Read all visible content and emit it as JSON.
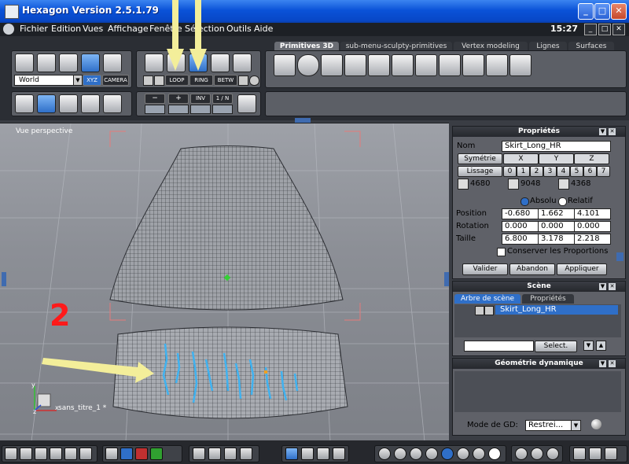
{
  "window": {
    "title": "Hexagon Version 2.5.1.79",
    "min_glyph": "_",
    "max_glyph": "□",
    "close_glyph": "✕"
  },
  "menubar": {
    "items": [
      "Fichier",
      "Edition",
      "Vues",
      "Affichage",
      "Fenêtre",
      "Sélection",
      "Outils",
      "Aide"
    ],
    "clock": "15:27",
    "min_glyph": "_",
    "max_glyph": "□",
    "close_glyph": "✕"
  },
  "toolbar": {
    "coord_select": "World",
    "xyz_label": "XYZ",
    "camera_label": "CAMERA",
    "loop_label": "LOOP",
    "ring_label": "RING",
    "betw_label": "BETW",
    "minus_label": "−",
    "plus_label": "+",
    "inv_label": "INV",
    "one_n_label": "1 / N",
    "tabs": [
      "Primitives 3D",
      "sub-menu-sculpty-primitives",
      "Vertex modeling",
      "Lignes",
      "Surfaces"
    ],
    "active_tab": "Primitives 3D"
  },
  "viewport": {
    "label": "Vue perspective",
    "step_number": "2",
    "object_label": "sans_titre_1 *",
    "axis_x": "x",
    "axis_y": "y",
    "axis_z": "z"
  },
  "properties": {
    "title": "Propriétés",
    "name_label": "Nom",
    "name_value": "Skirt_Long_HR",
    "symetrie_label": "Symétrie",
    "axes": [
      "X",
      "Y",
      "Z"
    ],
    "lissage_label": "Lissage",
    "lissage_levels": [
      "0",
      "1",
      "2",
      "3",
      "4",
      "5",
      "6",
      "7"
    ],
    "counts": [
      "4680",
      "9048",
      "4368"
    ],
    "absolu_label": "Absolu",
    "relatif_label": "Relatif",
    "position_label": "Position",
    "position": [
      "-0.680",
      "1.662",
      "4.101"
    ],
    "rotation_label": "Rotation",
    "rotation": [
      "0.000",
      "0.000",
      "0.000"
    ],
    "taille_label": "Taille",
    "taille": [
      "6.800",
      "3.178",
      "2.218"
    ],
    "conserver_label": "Conserver les Proportions",
    "valider_label": "Valider",
    "abandon_label": "Abandon",
    "appliquer_label": "Appliquer"
  },
  "scene": {
    "title": "Scène",
    "tab_tree": "Arbre de scène",
    "tab_props": "Propriétés",
    "item": "Skirt_Long_HR",
    "select_label": "Select."
  },
  "geometry": {
    "title": "Géométrie dynamique",
    "mode_label": "Mode de GD:",
    "mode_value": "Restrei..."
  },
  "colors": {
    "accent_blue": "#2f6fc8",
    "mesh_blue": "#3fb2f0",
    "annotation_arrow": "#f3ee9a",
    "step_number": "#ff1a1a"
  }
}
